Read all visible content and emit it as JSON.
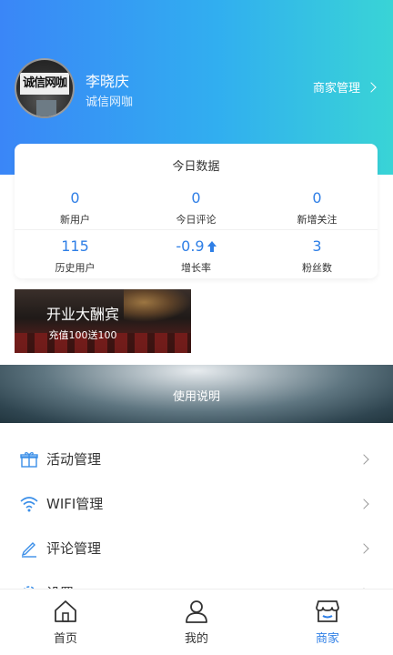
{
  "profile": {
    "name": "李晓庆",
    "shop_name": "诚信网咖",
    "avatar_sign_text": "诚信网咖",
    "manage_label": "商家管理"
  },
  "today_card": {
    "title": "今日数据",
    "stats": [
      {
        "value": "0",
        "label": "新用户"
      },
      {
        "value": "0",
        "label": "今日评论"
      },
      {
        "value": "0",
        "label": "新增关注"
      },
      {
        "value": "115",
        "label": "历史用户"
      },
      {
        "value": "-0.9",
        "label": "增长率",
        "icon": "up-arrow-icon"
      },
      {
        "value": "3",
        "label": "粉丝数"
      }
    ]
  },
  "promo": {
    "title": "开业大酬宾",
    "subtitle": "充值100送100"
  },
  "banner": {
    "label": "使用说明"
  },
  "menu": {
    "items": [
      {
        "label": "活动管理",
        "icon": "gift-icon"
      },
      {
        "label": "WIFI管理",
        "icon": "wifi-icon"
      },
      {
        "label": "评论管理",
        "icon": "edit-icon"
      },
      {
        "label": "设置",
        "icon": "gear-icon"
      }
    ]
  },
  "tabbar": {
    "tabs": [
      {
        "label": "首页",
        "icon": "home-icon"
      },
      {
        "label": "我的",
        "icon": "user-icon"
      },
      {
        "label": "商家",
        "icon": "store-icon",
        "active": true
      }
    ]
  },
  "colors": {
    "accent": "#2f7fe6",
    "header_gradient_start": "#3a86f7",
    "header_gradient_end": "#39d4d6",
    "icon_blue": "#3a8ee8"
  }
}
